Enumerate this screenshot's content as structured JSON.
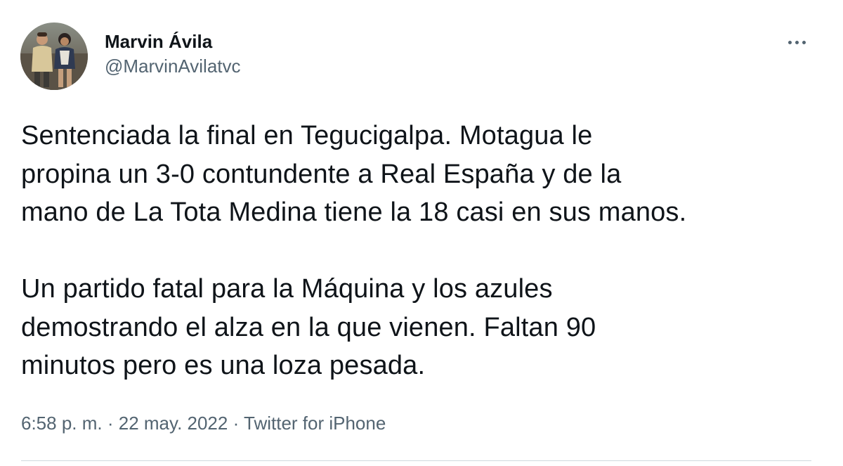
{
  "author": {
    "display_name": "Marvin Ávila",
    "handle": "@MarvinAvilatvc",
    "avatar_icon": "profile-photo-two-people"
  },
  "more_icon": "more-horizontal-icon",
  "tweet": {
    "paragraph1": [
      "Sentenciada la final en Tegucigalpa. Motagua le",
      "propina un 3-0 contundente a Real España y de la",
      "mano de La Tota Medina tiene la 18 casi en sus manos."
    ],
    "paragraph2": [
      "Un partido fatal para la Máquina y los azules",
      "demostrando el alza en la que vienen. Faltan 90",
      "minutos pero es una loza pesada."
    ]
  },
  "meta": {
    "time": "6:58 p. m.",
    "separator": " · ",
    "date": "22 may. 2022",
    "source": "Twitter for iPhone"
  },
  "colors": {
    "text_primary": "#0f1419",
    "text_secondary": "#536471",
    "divider": "#cfd9de"
  }
}
